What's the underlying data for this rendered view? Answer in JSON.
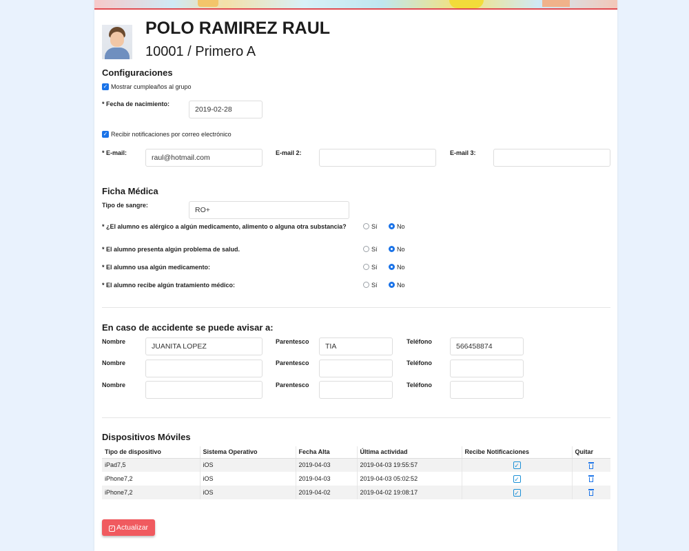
{
  "student": {
    "name": "POLO RAMIREZ RAUL",
    "group": "10001 / Primero A"
  },
  "config": {
    "title": "Configuraciones",
    "show_birthday_label": "Mostrar cumpleaños al grupo",
    "show_birthday_checked": true,
    "birthdate_label": "* Fecha de nacimiento:",
    "birthdate_value": "2019-02-28",
    "notify_email_label": "Recibir notificaciones por correo electrónico",
    "notify_email_checked": true,
    "email_label": "* E-mail:",
    "email_value": "raul@hotmail.com",
    "email2_label": "E-mail 2:",
    "email2_value": "",
    "email3_label": "E-mail 3:",
    "email3_value": ""
  },
  "medical": {
    "title": "Ficha Médica",
    "blood_label": "Tipo de sangre:",
    "blood_value": "RO+",
    "questions": [
      {
        "label": "* ¿El alumno es alérgico a algún medicamento, alimento o alguna otra substancia?",
        "yes": "Sí",
        "no": "No",
        "selected": "No"
      },
      {
        "label": "* El alumno presenta algún problema de salud.",
        "yes": "Sí",
        "no": "No",
        "selected": "No"
      },
      {
        "label": "* El alumno usa algún medicamento:",
        "yes": "Sí",
        "no": "No",
        "selected": "No"
      },
      {
        "label": "* El alumno recibe algún tratamiento médico:",
        "yes": "Sí",
        "no": "No",
        "selected": "No"
      }
    ]
  },
  "emergency": {
    "title": "En caso de accidente se puede avisar a:",
    "name_label": "Nombre",
    "relation_label": "Parentesco",
    "phone_label": "Teléfono",
    "contacts": [
      {
        "name": "JUANITA LOPEZ",
        "relation": "TIA",
        "phone": "566458874"
      },
      {
        "name": "",
        "relation": "",
        "phone": ""
      },
      {
        "name": "",
        "relation": "",
        "phone": ""
      }
    ]
  },
  "devices": {
    "title": "Dispositivos Móviles",
    "headers": [
      "Tipo de dispositivo",
      "Sistema Operativo",
      "Fecha Alta",
      "Última actividad",
      "Recibe Notificaciones",
      "Quitar"
    ],
    "rows": [
      {
        "type": "iPad7,5",
        "os": "iOS",
        "date": "2019-04-03",
        "last": "2019-04-03 19:55:57",
        "notify": true
      },
      {
        "type": "iPhone7,2",
        "os": "iOS",
        "date": "2019-04-03",
        "last": "2019-04-03 05:02:52",
        "notify": true
      },
      {
        "type": "iPhone7,2",
        "os": "iOS",
        "date": "2019-04-02",
        "last": "2019-04-02 19:08:17",
        "notify": true
      }
    ]
  },
  "actions": {
    "update_label": "Actualizar"
  },
  "colors": {
    "accent": "#1a73e8",
    "button": "#f05a5f",
    "background": "#e9f2fd"
  }
}
